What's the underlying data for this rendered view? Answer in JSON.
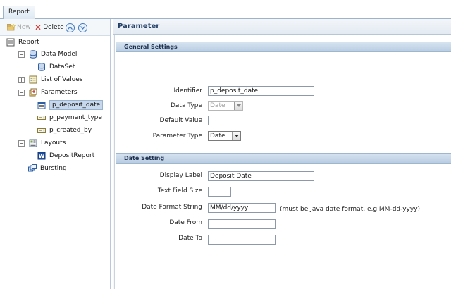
{
  "tab": {
    "label": "Report"
  },
  "toolbar": {
    "new_label": "New",
    "delete_label": "Delete",
    "up_icon": "chevron-up-circle-icon",
    "down_icon": "chevron-down-circle-icon"
  },
  "tree": {
    "root": "Report",
    "data_model": "Data Model",
    "dataset": "DataSet",
    "list_of_values": "List of Values",
    "parameters": "Parameters",
    "param_deposit_date": "p_deposit_date",
    "param_payment_type": "p_payment_type",
    "param_created_by": "p_created_by",
    "layouts": "Layouts",
    "deposit_report": "DepositReport",
    "bursting": "Bursting"
  },
  "panel": {
    "title": "Parameter"
  },
  "general": {
    "heading": "General Settings",
    "identifier_label": "Identifier",
    "identifier_value": "p_deposit_date",
    "data_type_label": "Data Type",
    "data_type_value": "Date",
    "default_value_label": "Default Value",
    "default_value_value": "",
    "parameter_type_label": "Parameter Type",
    "parameter_type_value": "Date"
  },
  "date_setting": {
    "heading": "Date Setting",
    "display_label_label": "Display Label",
    "display_label_value": "Deposit Date",
    "text_field_size_label": "Text Field Size",
    "text_field_size_value": "",
    "date_format_label": "Date Format String",
    "date_format_value": "MM/dd/yyyy",
    "date_format_hint": "(must be Java date format, e.g MM-dd-yyyy)",
    "date_from_label": "Date From",
    "date_from_value": "",
    "date_to_label": "Date To",
    "date_to_value": ""
  },
  "colors": {
    "selection": "#c8d8ec",
    "section_header": "#b9cde2",
    "title_text": "#233f66",
    "delete_red": "#d0241c"
  }
}
